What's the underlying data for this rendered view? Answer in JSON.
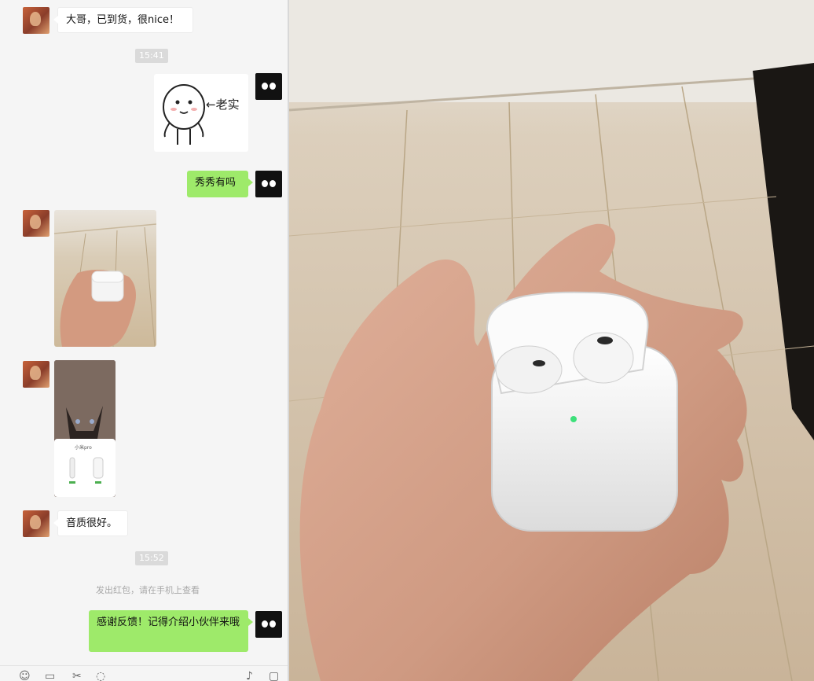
{
  "messages": {
    "m1_text": "大哥，已到货，很nice！",
    "time1": "15:41",
    "sticker_label": "←老实",
    "m3_text": "秀秀有吗",
    "screenshot_title": "小米pro",
    "m6_text": "音质很好。",
    "time2": "15:52",
    "system_notice": "发出红包，请在手机上查看",
    "m8_text": "感谢反馈！记得介绍小伙伴来哦"
  },
  "toolbar": {
    "emoji_icon": "smile-icon",
    "folder_icon": "folder-icon",
    "scissors_icon": "scissors-icon",
    "chat_icon": "chat-icon",
    "mic_icon": "mic-icon",
    "video_icon": "video-icon"
  },
  "colors": {
    "outgoing_bubble": "#9eea6a",
    "incoming_bubble": "#ffffff",
    "background": "#f5f5f5"
  }
}
